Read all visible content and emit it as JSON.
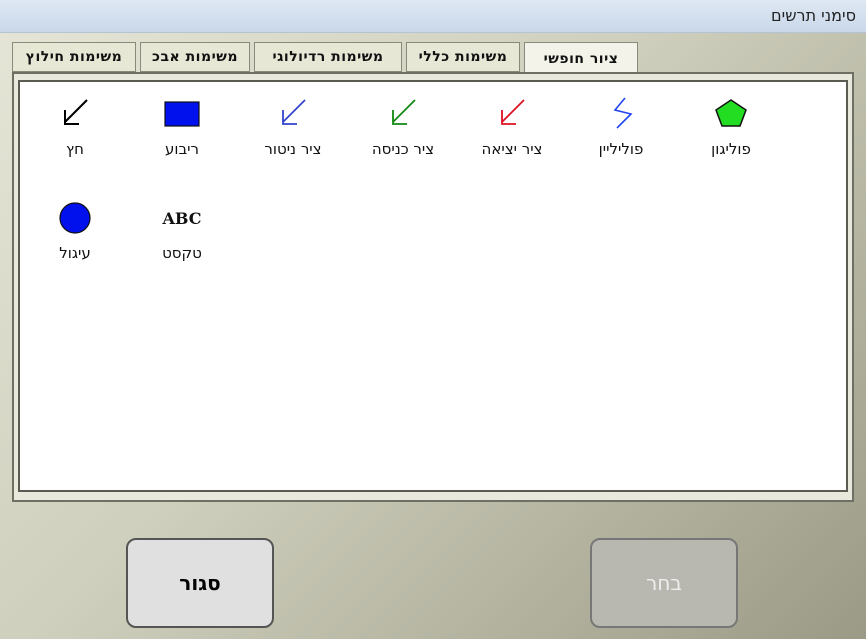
{
  "window": {
    "title": "סימני תרשים"
  },
  "tabs": [
    {
      "label": "ציור חופשי"
    },
    {
      "label": "משימות כללי"
    },
    {
      "label": "משימות רדיולוגי"
    },
    {
      "label": "משימות אבכ"
    },
    {
      "label": "משימות חילוץ"
    }
  ],
  "tools": {
    "polygon": "פוליגון",
    "polyline": "פוליליין",
    "exit_draw": "ציר יציאה",
    "entry_draw": "ציר כניסה",
    "monitor_draw": "ציר ניטור",
    "rectangle": "ריבוע",
    "arrow": "חץ",
    "text": "טקסט",
    "text_icon": "ABC",
    "circle": "עיגול"
  },
  "buttons": {
    "close": "סגור",
    "choose": "בחר"
  },
  "colors": {
    "polygon": "#22dd22",
    "polyline": "#2244ee",
    "exit": "#dd1122",
    "entry": "#118811",
    "monitor": "#3344cc",
    "rectangle": "#0011ee",
    "arrow": "#000000",
    "circle": "#0011ee"
  }
}
